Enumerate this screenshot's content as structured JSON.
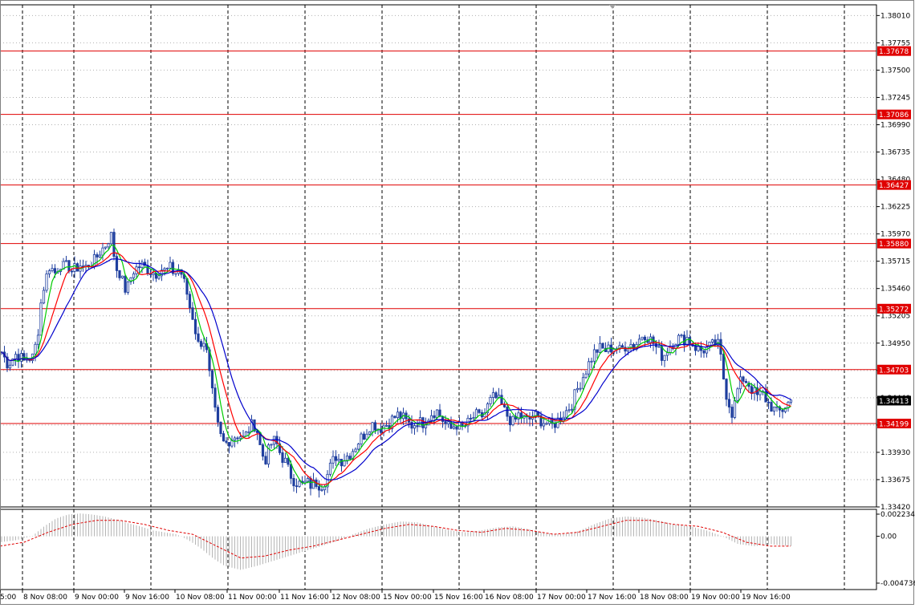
{
  "chart_data": {
    "type": "line",
    "instrument_chart": "candlestick with moving averages, horizontal levels and MACD sub-window",
    "price_axis": {
      "range": [
        1.3342,
        1.3811
      ],
      "tick_labels": [
        "1.38010",
        "1.37755",
        "1.37500",
        "1.37245",
        "1.36990",
        "1.36735",
        "1.36480",
        "1.36225",
        "1.35970",
        "1.35715",
        "1.35460",
        "1.35205",
        "1.34950",
        "1.34695",
        "1.34440",
        "1.34185",
        "1.33930",
        "1.33675",
        "1.33420"
      ]
    },
    "time_axis": {
      "tick_labels": [
        "5:00",
        "8 Nov 08:00",
        "9 Nov 00:00",
        "9 Nov 16:00",
        "10 Nov 08:00",
        "11 Nov 00:00",
        "11 Nov 16:00",
        "12 Nov 08:00",
        "15 Nov 00:00",
        "15 Nov 16:00",
        "16 Nov 08:00",
        "17 Nov 00:00",
        "17 Nov 16:00",
        "18 Nov 08:00",
        "19 Nov 00:00",
        "19 Nov 16:00"
      ]
    },
    "levels": [
      {
        "value": 1.37678,
        "label": "1.37678"
      },
      {
        "value": 1.37086,
        "label": "1.37086"
      },
      {
        "value": 1.36427,
        "label": "1.36427"
      },
      {
        "value": 1.3588,
        "label": "1.35880"
      },
      {
        "value": 1.35272,
        "label": "1.35272"
      },
      {
        "value": 1.34703,
        "label": "1.34703"
      },
      {
        "value": 1.34199,
        "label": "1.34199"
      }
    ],
    "current_price": {
      "value": 1.34413,
      "label": "1.34413"
    },
    "price_path": [
      [
        0,
        1.349
      ],
      [
        5,
        1.3482
      ],
      [
        10,
        1.3475
      ],
      [
        15,
        1.348
      ],
      [
        20,
        1.3485
      ],
      [
        25,
        1.3482
      ],
      [
        30,
        1.3478
      ],
      [
        35,
        1.3482
      ],
      [
        40,
        1.348
      ],
      [
        45,
        1.3495
      ],
      [
        48,
        1.351
      ],
      [
        52,
        1.354
      ],
      [
        57,
        1.3555
      ],
      [
        62,
        1.3568
      ],
      [
        68,
        1.356
      ],
      [
        75,
        1.357
      ],
      [
        80,
        1.3565
      ],
      [
        85,
        1.3568
      ],
      [
        90,
        1.3562
      ],
      [
        95,
        1.3565
      ],
      [
        100,
        1.3568
      ],
      [
        106,
        1.3565
      ],
      [
        112,
        1.357
      ],
      [
        118,
        1.3572
      ],
      [
        124,
        1.358
      ],
      [
        130,
        1.3585
      ],
      [
        134,
        1.359
      ],
      [
        138,
        1.3598
      ],
      [
        141,
        1.3582
      ],
      [
        145,
        1.3565
      ],
      [
        150,
        1.356
      ],
      [
        155,
        1.3545
      ],
      [
        160,
        1.3548
      ],
      [
        165,
        1.3562
      ],
      [
        170,
        1.3565
      ],
      [
        176,
        1.3568
      ],
      [
        182,
        1.3565
      ],
      [
        188,
        1.3562
      ],
      [
        194,
        1.356
      ],
      [
        200,
        1.3565
      ],
      [
        206,
        1.3562
      ],
      [
        212,
        1.3565
      ],
      [
        218,
        1.356
      ],
      [
        224,
        1.3565
      ],
      [
        228,
        1.3555
      ],
      [
        232,
        1.3545
      ],
      [
        236,
        1.353
      ],
      [
        240,
        1.352
      ],
      [
        244,
        1.3505
      ],
      [
        248,
        1.349
      ],
      [
        252,
        1.35
      ],
      [
        256,
        1.3495
      ],
      [
        260,
        1.347
      ],
      [
        264,
        1.345
      ],
      [
        268,
        1.343
      ],
      [
        272,
        1.3415
      ],
      [
        276,
        1.3405
      ],
      [
        280,
        1.34
      ],
      [
        286,
        1.3405
      ],
      [
        292,
        1.3408
      ],
      [
        298,
        1.341
      ],
      [
        304,
        1.3405
      ],
      [
        310,
        1.3415
      ],
      [
        316,
        1.342
      ],
      [
        320,
        1.3415
      ],
      [
        325,
        1.3395
      ],
      [
        330,
        1.3385
      ],
      [
        335,
        1.3395
      ],
      [
        340,
        1.3405
      ],
      [
        345,
        1.34
      ],
      [
        350,
        1.339
      ],
      [
        355,
        1.3385
      ],
      [
        360,
        1.3375
      ],
      [
        365,
        1.3368
      ],
      [
        370,
        1.3365
      ],
      [
        376,
        1.3362
      ],
      [
        382,
        1.3365
      ],
      [
        388,
        1.3362
      ],
      [
        394,
        1.3365
      ],
      [
        400,
        1.3362
      ],
      [
        406,
        1.3368
      ],
      [
        412,
        1.338
      ],
      [
        418,
        1.339
      ],
      [
        424,
        1.3385
      ],
      [
        430,
        1.3388
      ],
      [
        436,
        1.3392
      ],
      [
        442,
        1.3398
      ],
      [
        448,
        1.3405
      ],
      [
        454,
        1.341
      ],
      [
        460,
        1.3418
      ],
      [
        466,
        1.342
      ],
      [
        472,
        1.3415
      ],
      [
        478,
        1.3418
      ],
      [
        484,
        1.342
      ],
      [
        490,
        1.3425
      ],
      [
        496,
        1.3428
      ],
      [
        502,
        1.3425
      ],
      [
        508,
        1.342
      ],
      [
        514,
        1.3418
      ],
      [
        520,
        1.3422
      ],
      [
        526,
        1.342
      ],
      [
        532,
        1.3425
      ],
      [
        538,
        1.343
      ],
      [
        544,
        1.3432
      ],
      [
        550,
        1.3425
      ],
      [
        556,
        1.3418
      ],
      [
        562,
        1.3415
      ],
      [
        568,
        1.342
      ],
      [
        574,
        1.3415
      ],
      [
        580,
        1.3418
      ],
      [
        586,
        1.3422
      ],
      [
        592,
        1.3428
      ],
      [
        598,
        1.3425
      ],
      [
        604,
        1.343
      ],
      [
        610,
        1.344
      ],
      [
        616,
        1.3445
      ],
      [
        622,
        1.344
      ],
      [
        628,
        1.3432
      ],
      [
        634,
        1.3425
      ],
      [
        640,
        1.342
      ],
      [
        646,
        1.3428
      ],
      [
        652,
        1.3425
      ],
      [
        658,
        1.3422
      ],
      [
        664,
        1.3428
      ],
      [
        670,
        1.3425
      ],
      [
        676,
        1.3422
      ],
      [
        682,
        1.342
      ],
      [
        688,
        1.3418
      ],
      [
        694,
        1.3422
      ],
      [
        700,
        1.3428
      ],
      [
        706,
        1.3432
      ],
      [
        712,
        1.3438
      ],
      [
        718,
        1.345
      ],
      [
        724,
        1.346
      ],
      [
        730,
        1.347
      ],
      [
        736,
        1.348
      ],
      [
        742,
        1.3488
      ],
      [
        748,
        1.349
      ],
      [
        754,
        1.3488
      ],
      [
        760,
        1.349
      ],
      [
        766,
        1.3492
      ],
      [
        772,
        1.3488
      ],
      [
        778,
        1.3492
      ],
      [
        784,
        1.3495
      ],
      [
        790,
        1.3492
      ],
      [
        796,
        1.3498
      ],
      [
        802,
        1.3505
      ],
      [
        808,
        1.35
      ],
      [
        814,
        1.3495
      ],
      [
        820,
        1.3488
      ],
      [
        826,
        1.3482
      ],
      [
        832,
        1.349
      ],
      [
        838,
        1.3495
      ],
      [
        844,
        1.35
      ],
      [
        850,
        1.3498
      ],
      [
        856,
        1.35
      ],
      [
        862,
        1.3495
      ],
      [
        868,
        1.349
      ],
      [
        874,
        1.3488
      ],
      [
        880,
        1.349
      ],
      [
        886,
        1.3492
      ],
      [
        892,
        1.3495
      ],
      [
        896,
        1.3492
      ],
      [
        900,
        1.347
      ],
      [
        904,
        1.345
      ],
      [
        908,
        1.344
      ],
      [
        912,
        1.343
      ],
      [
        916,
        1.344
      ],
      [
        920,
        1.3455
      ],
      [
        926,
        1.3462
      ],
      [
        932,
        1.3458
      ],
      [
        938,
        1.345
      ],
      [
        944,
        1.3445
      ],
      [
        950,
        1.3448
      ],
      [
        956,
        1.344
      ],
      [
        962,
        1.3435
      ],
      [
        968,
        1.343
      ],
      [
        974,
        1.3432
      ],
      [
        980,
        1.3438
      ],
      [
        985,
        1.3441
      ]
    ],
    "moving_averages": [
      {
        "color": "#00cc00",
        "period_bars": 5
      },
      {
        "color": "#ff0000",
        "period_bars": 10
      },
      {
        "color": "#0000cc",
        "period_bars": 17
      }
    ],
    "macd": {
      "tick_labels": [
        "0.002234",
        "0.00",
        "-0.004736"
      ],
      "range": [
        -0.004736,
        0.002234
      ],
      "histogram": [
        [
          0,
          -0.0006
        ],
        [
          20,
          -0.0004
        ],
        [
          40,
          0.0
        ],
        [
          55,
          0.001
        ],
        [
          70,
          0.0018
        ],
        [
          85,
          0.0022
        ],
        [
          100,
          0.0023
        ],
        [
          115,
          0.0022
        ],
        [
          130,
          0.002
        ],
        [
          145,
          0.0017
        ],
        [
          160,
          0.0013
        ],
        [
          175,
          0.001
        ],
        [
          190,
          0.0006
        ],
        [
          205,
          0.0004
        ],
        [
          220,
          0.0002
        ],
        [
          235,
          -0.0004
        ],
        [
          250,
          -0.0012
        ],
        [
          265,
          -0.0022
        ],
        [
          280,
          -0.003
        ],
        [
          300,
          -0.0034
        ],
        [
          320,
          -0.003
        ],
        [
          340,
          -0.0025
        ],
        [
          360,
          -0.002
        ],
        [
          380,
          -0.0015
        ],
        [
          400,
          -0.001
        ],
        [
          420,
          -0.0005
        ],
        [
          440,
          0.0002
        ],
        [
          460,
          0.0008
        ],
        [
          480,
          0.0012
        ],
        [
          500,
          0.0015
        ],
        [
          520,
          0.0014
        ],
        [
          540,
          0.001
        ],
        [
          560,
          0.0006
        ],
        [
          580,
          0.0004
        ],
        [
          600,
          0.0006
        ],
        [
          620,
          0.0009
        ],
        [
          640,
          0.001
        ],
        [
          660,
          0.0007
        ],
        [
          680,
          0.0003
        ],
        [
          700,
          0.0002
        ],
        [
          720,
          0.0005
        ],
        [
          740,
          0.0012
        ],
        [
          760,
          0.0018
        ],
        [
          780,
          0.002
        ],
        [
          800,
          0.0019
        ],
        [
          820,
          0.0016
        ],
        [
          840,
          0.0012
        ],
        [
          860,
          0.001
        ],
        [
          880,
          0.0006
        ],
        [
          900,
          0.0
        ],
        [
          920,
          -0.0008
        ],
        [
          940,
          -0.001
        ],
        [
          960,
          -0.0008
        ],
        [
          985,
          -0.001
        ]
      ],
      "signal_line": [
        [
          0,
          -0.001
        ],
        [
          30,
          -0.0006
        ],
        [
          60,
          0.0004
        ],
        [
          90,
          0.0012
        ],
        [
          120,
          0.0016
        ],
        [
          150,
          0.0016
        ],
        [
          180,
          0.0012
        ],
        [
          210,
          0.0006
        ],
        [
          240,
          0.0002
        ],
        [
          270,
          -0.001
        ],
        [
          300,
          -0.0022
        ],
        [
          330,
          -0.002
        ],
        [
          360,
          -0.0014
        ],
        [
          390,
          -0.001
        ],
        [
          420,
          -0.0004
        ],
        [
          450,
          0.0002
        ],
        [
          480,
          0.0008
        ],
        [
          510,
          0.0012
        ],
        [
          540,
          0.001
        ],
        [
          570,
          0.0006
        ],
        [
          600,
          0.0004
        ],
        [
          630,
          0.0008
        ],
        [
          660,
          0.0006
        ],
        [
          690,
          0.0002
        ],
        [
          720,
          0.0004
        ],
        [
          750,
          0.001
        ],
        [
          780,
          0.0016
        ],
        [
          810,
          0.0016
        ],
        [
          840,
          0.0012
        ],
        [
          870,
          0.001
        ],
        [
          900,
          0.0004
        ],
        [
          930,
          -0.0006
        ],
        [
          960,
          -0.001
        ],
        [
          985,
          -0.001
        ]
      ]
    }
  }
}
